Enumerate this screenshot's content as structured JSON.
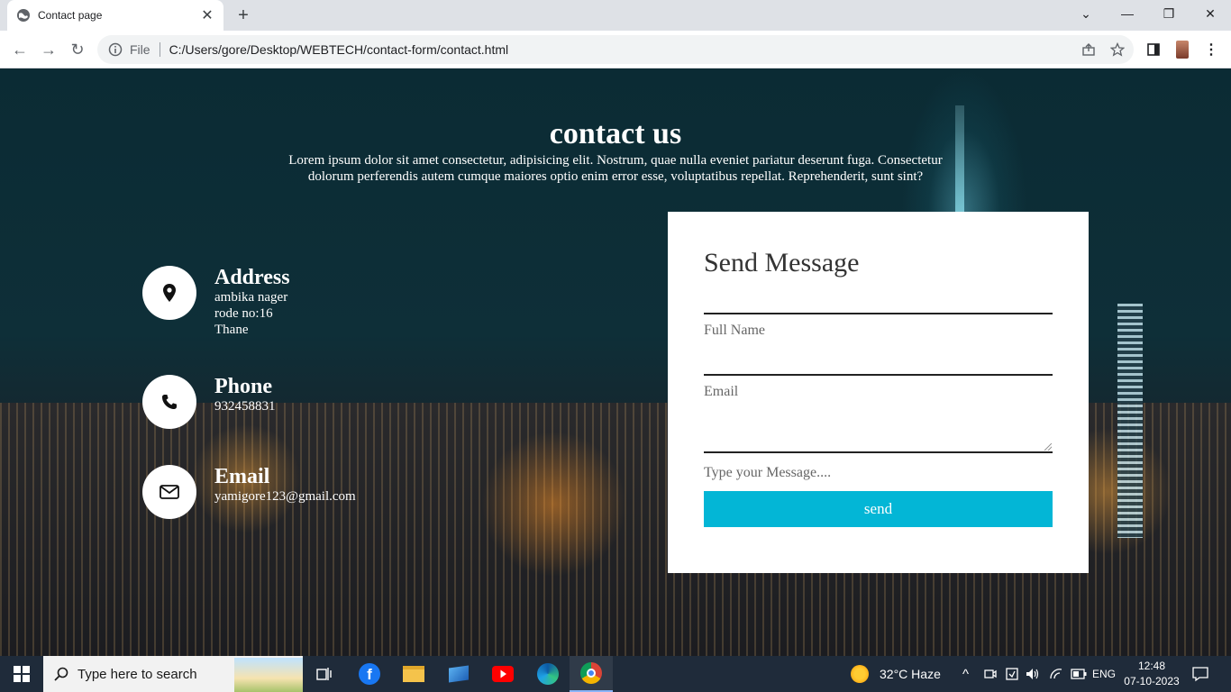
{
  "browser": {
    "tab_title": "Contact page",
    "address_prefix": "File",
    "url": "C:/Users/gore/Desktop/WEBTECH/contact-form/contact.html"
  },
  "page": {
    "heading": "contact us",
    "intro_line1": "Lorem ipsum dolor sit amet consectetur, adipisicing elit. Nostrum, quae nulla eveniet pariatur deserunt fuga. Consectetur",
    "intro_line2": "dolorum perferendis autem cumque maiores optio enim error esse, voluptatibus repellat. Reprehenderit, sunt sint?",
    "contact_items": [
      {
        "icon": "map-pin-icon",
        "title": "Address",
        "lines": [
          "ambika nager",
          "rode no:16",
          "Thane"
        ]
      },
      {
        "icon": "phone-icon",
        "title": "Phone",
        "lines": [
          "932458831"
        ]
      },
      {
        "icon": "envelope-icon",
        "title": "Email",
        "lines": [
          "yamigore123@gmail.com"
        ]
      }
    ],
    "form": {
      "title": "Send Message",
      "full_name_label": "Full Name",
      "email_label": "Email",
      "message_label": "Type your Message....",
      "send_label": "send",
      "button_color": "#03b6d6"
    }
  },
  "taskbar": {
    "search_placeholder": "Type here to search",
    "weather": "32°C  Haze",
    "language": "ENG",
    "time": "12:48",
    "date": "07-10-2023",
    "apps": [
      "task-view-icon",
      "facebook-icon",
      "file-explorer-icon",
      "windows-app-icon",
      "youtube-icon",
      "edge-icon",
      "chrome-icon"
    ]
  }
}
